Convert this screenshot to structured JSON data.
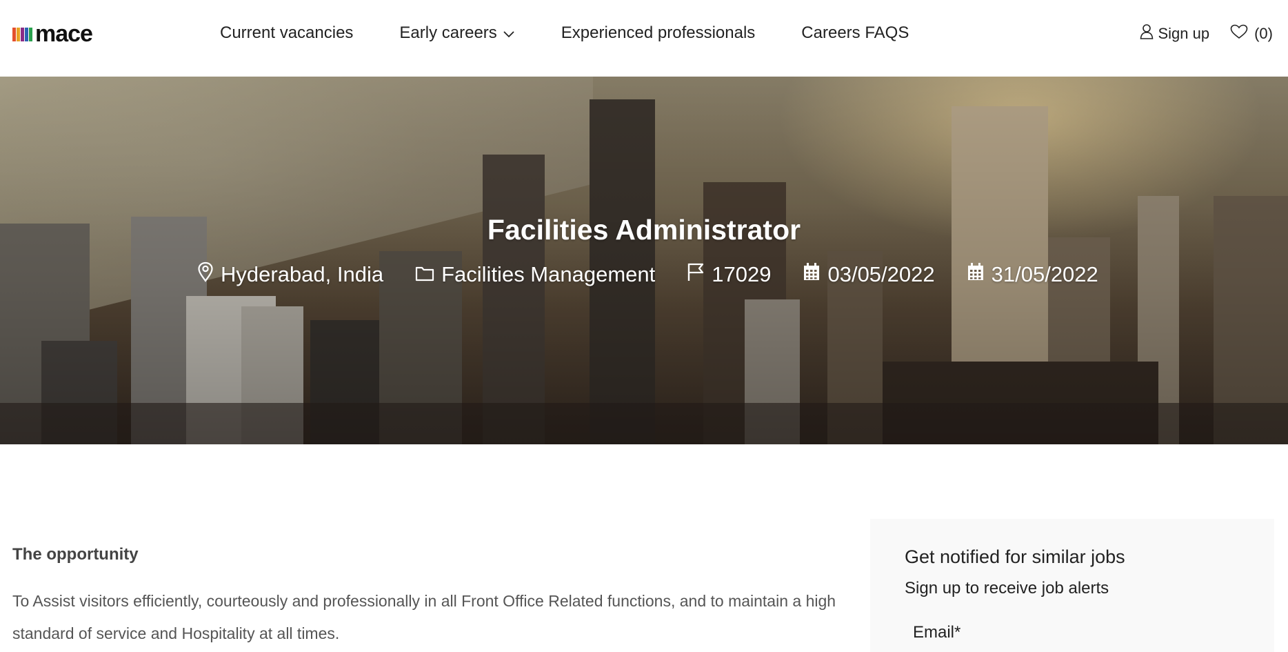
{
  "brand": {
    "logo_text": "mace",
    "bar_colors": [
      "#e4502d",
      "#e8a224",
      "#8a2b86",
      "#2b62b2",
      "#2aa14e"
    ]
  },
  "nav": {
    "items": [
      {
        "label": "Current vacancies"
      },
      {
        "label": "Early careers",
        "has_dropdown": true
      },
      {
        "label": "Experienced professionals"
      },
      {
        "label": "Careers FAQS"
      }
    ]
  },
  "header_actions": {
    "signup_label": "Sign up",
    "favorites_count": "(0)"
  },
  "job": {
    "title": "Facilities Administrator",
    "location": "Hyderabad, India",
    "category": "Facilities Management",
    "reference": "17029",
    "posted_date": "03/05/2022",
    "closing_date": "31/05/2022"
  },
  "opportunity": {
    "heading": "The opportunity",
    "text": "To Assist visitors efficiently, courteously and professionally in all Front Office Related functions, and to maintain a high standard of service and Hospitality at all times."
  },
  "alerts": {
    "title": "Get notified for similar jobs",
    "subtitle": "Sign up to receive job alerts",
    "email_label": "Email*"
  }
}
